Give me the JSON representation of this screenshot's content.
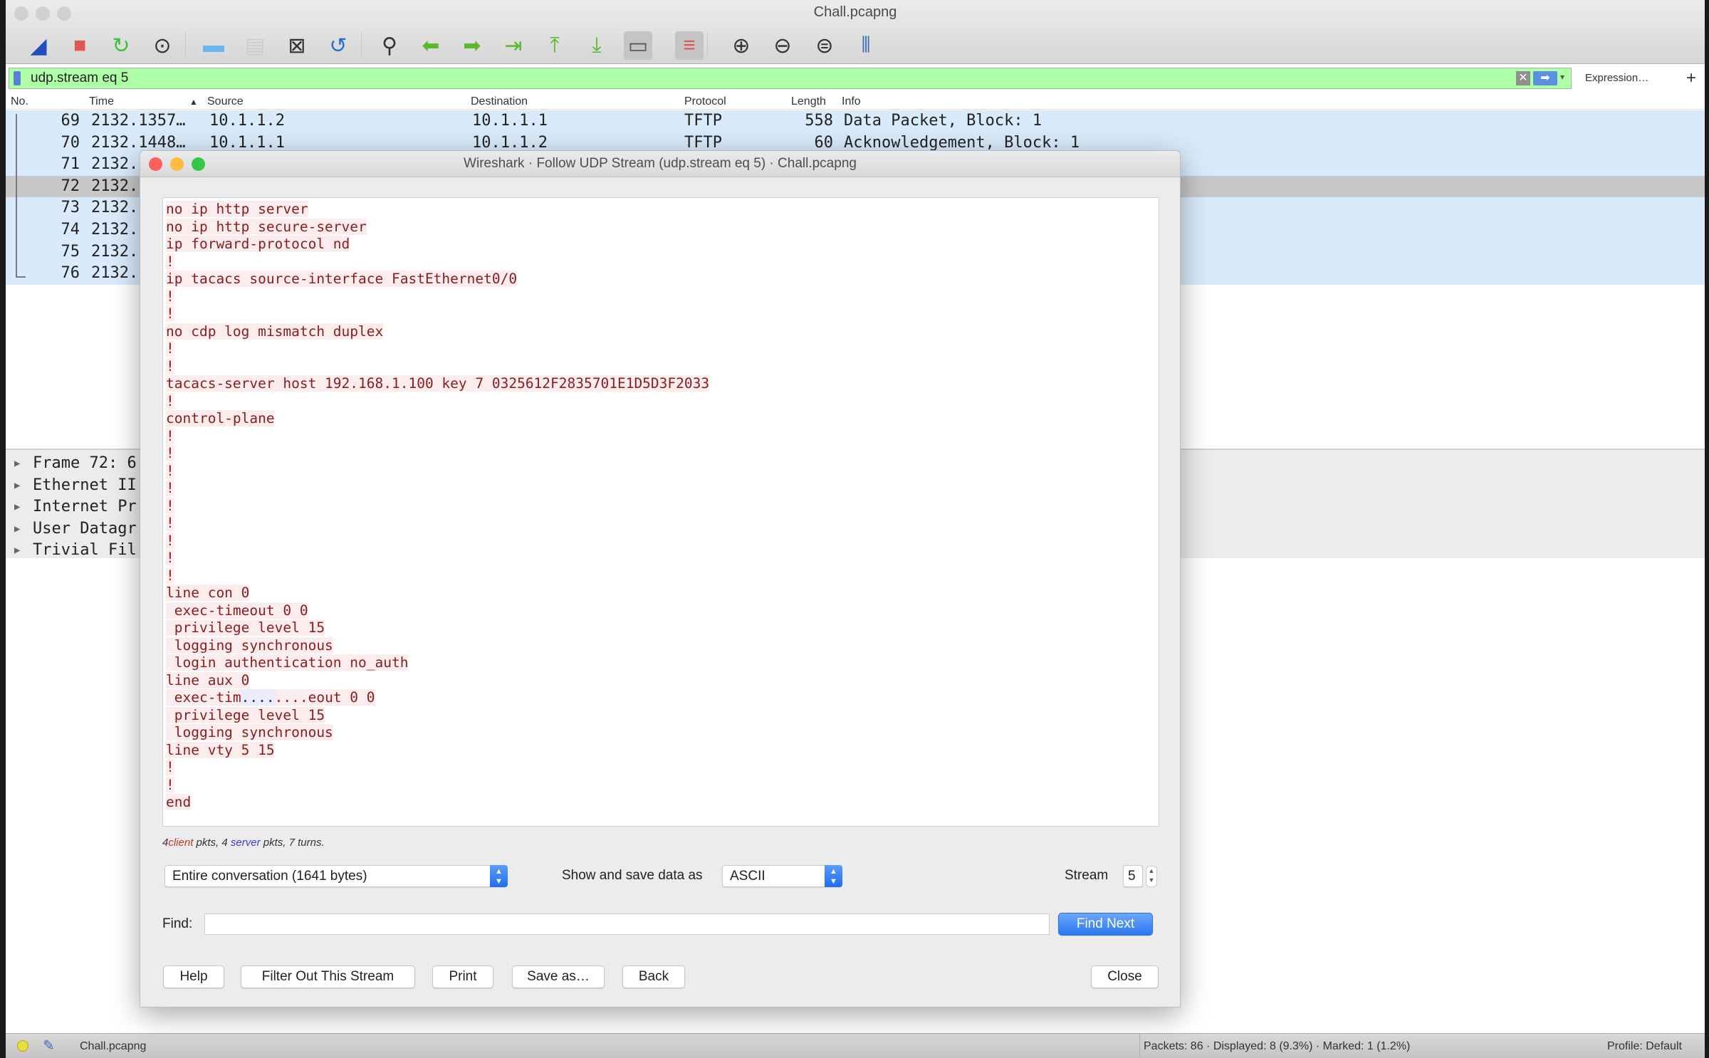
{
  "window": {
    "title": "Chall.pcapng"
  },
  "toolbar": {
    "icons": [
      "shark-fin-start-icon",
      "stop-capture-icon",
      "restart-capture-icon",
      "capture-options-gear-icon",
      "open-folder-icon",
      "save-file-icon",
      "close-file-icon",
      "reload-file-icon",
      "find-packet-icon",
      "go-back-arrow-icon",
      "go-forward-arrow-icon",
      "go-to-packet-icon",
      "first-packet-icon",
      "last-packet-icon",
      "auto-scroll-icon",
      "colorize-icon",
      "zoom-in-icon",
      "zoom-out-icon",
      "normal-size-icon",
      "resize-columns-icon"
    ]
  },
  "filter": {
    "value": "udp.stream eq 5",
    "expression_label": "Expression…",
    "add_label": "+"
  },
  "packet_list": {
    "columns": [
      "No.",
      "Time",
      "Source",
      "Destination",
      "Protocol",
      "Length",
      "Info"
    ],
    "rows": [
      {
        "no": "69",
        "time": "2132.1357…",
        "source": "10.1.1.2",
        "destination": "10.1.1.1",
        "protocol": "TFTP",
        "length": "558",
        "info": "Data Packet, Block: 1"
      },
      {
        "no": "70",
        "time": "2132.1448…",
        "source": "10.1.1.1",
        "destination": "10.1.1.2",
        "protocol": "TFTP",
        "length": "60",
        "info": "Acknowledgement, Block: 1"
      },
      {
        "no": "71",
        "time": "2132."
      },
      {
        "no": "72",
        "time": "2132.",
        "selected": true
      },
      {
        "no": "73",
        "time": "2132."
      },
      {
        "no": "74",
        "time": "2132."
      },
      {
        "no": "75",
        "time": "2132."
      },
      {
        "no": "76",
        "time": "2132."
      }
    ]
  },
  "packet_details": [
    "Frame 72: 6",
    "Ethernet II",
    "Internet Pr",
    "User Datagr",
    "Trivial Fil"
  ],
  "dialog": {
    "title": "Wireshark · Follow UDP Stream (udp.stream eq 5) · Chall.pcapng",
    "colors": {
      "client": "#8a1c1c",
      "server": "#1e1ea6"
    },
    "stream_lines": [
      [
        {
          "t": "no ip http server",
          "s": "client"
        }
      ],
      [
        {
          "t": "no ip http secure-server",
          "s": "client"
        }
      ],
      [
        {
          "t": "ip forward-protocol nd",
          "s": "client"
        }
      ],
      [
        {
          "t": "!",
          "s": "client"
        }
      ],
      [
        {
          "t": "ip tacacs source-interface FastEthernet0/0",
          "s": "client"
        }
      ],
      [
        {
          "t": "!",
          "s": "client"
        }
      ],
      [
        {
          "t": "!",
          "s": "client"
        }
      ],
      [
        {
          "t": "no cdp log mismatch duplex",
          "s": "client"
        }
      ],
      [
        {
          "t": "!",
          "s": "client"
        }
      ],
      [
        {
          "t": "!",
          "s": "client"
        }
      ],
      [
        {
          "t": "tacacs-server host 192.168.1.100 key 7 0325612F2835701E1D5D3F2033",
          "s": "client"
        }
      ],
      [
        {
          "t": "!",
          "s": "client"
        }
      ],
      [
        {
          "t": "control-plane",
          "s": "client"
        }
      ],
      [
        {
          "t": "!",
          "s": "client"
        }
      ],
      [
        {
          "t": "!",
          "s": "client"
        }
      ],
      [
        {
          "t": "!",
          "s": "client"
        }
      ],
      [
        {
          "t": "!",
          "s": "client"
        }
      ],
      [
        {
          "t": "!",
          "s": "client"
        }
      ],
      [
        {
          "t": "!",
          "s": "client"
        }
      ],
      [
        {
          "t": "!",
          "s": "client"
        }
      ],
      [
        {
          "t": "!",
          "s": "client"
        }
      ],
      [
        {
          "t": "!",
          "s": "client"
        }
      ],
      [
        {
          "t": "line con 0",
          "s": "client"
        }
      ],
      [
        {
          "t": " exec-timeout 0 0",
          "s": "client"
        }
      ],
      [
        {
          "t": " privilege level 15",
          "s": "client"
        }
      ],
      [
        {
          "t": " logging synchronous",
          "s": "client"
        }
      ],
      [
        {
          "t": " login authentication no_auth",
          "s": "client"
        }
      ],
      [
        {
          "t": "line aux 0",
          "s": "client"
        }
      ],
      [
        {
          "t": " exec-tim",
          "s": "client"
        },
        {
          "t": "....",
          "s": "server"
        },
        {
          "t": "....eout 0 0",
          "s": "client"
        }
      ],
      [
        {
          "t": " privilege level 15",
          "s": "client"
        }
      ],
      [
        {
          "t": " logging synchronous",
          "s": "client"
        }
      ],
      [
        {
          "t": "line vty 5 15",
          "s": "client"
        }
      ],
      [
        {
          "t": "!",
          "s": "client"
        }
      ],
      [
        {
          "t": "!",
          "s": "client"
        }
      ],
      [
        {
          "t": "end",
          "s": "client"
        }
      ],
      [
        {
          "t": "",
          "s": "client"
        }
      ],
      [
        {
          "t": "    ",
          "s": "server"
        }
      ]
    ],
    "summary": {
      "client_count": "4",
      "client_word": "client",
      "mid": " pkts, 4 ",
      "server_word": "server",
      "tail": " pkts, 7 turns."
    },
    "conversation_select": "Entire conversation (1641 bytes)",
    "show_as_label": "Show and save data as",
    "show_as_value": "ASCII",
    "stream_label": "Stream",
    "stream_value": "5",
    "find_label": "Find:",
    "find_value": "",
    "find_next": "Find Next",
    "buttons": {
      "help": "Help",
      "filter_out": "Filter Out This Stream",
      "print": "Print",
      "save_as": "Save as…",
      "back": "Back",
      "close": "Close"
    }
  },
  "status": {
    "file": "Chall.pcapng",
    "stats": "Packets: 86 · Displayed: 8 (9.3%) · Marked: 1 (1.2%)",
    "profile": "Profile: Default"
  }
}
